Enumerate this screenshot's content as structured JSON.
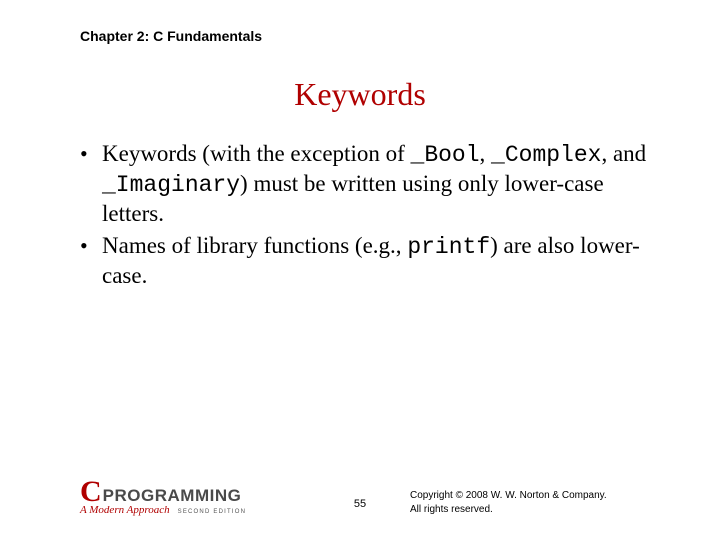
{
  "chapter": "Chapter 2: C Fundamentals",
  "title": "Keywords",
  "bullets": [
    {
      "pre": "Keywords (with the exception of ",
      "c1": "_Bool",
      "mid1": ", ",
      "c2": "_Complex",
      "mid2": ", and ",
      "c3": "_Imaginary",
      "post": ") must be written using only lower-case letters."
    },
    {
      "pre": "Names of library functions (e.g., ",
      "c1": "printf",
      "post": ") are also lower-case."
    }
  ],
  "logo": {
    "c": "C",
    "prog": "PROGRAMMING",
    "sub": "A Modern Approach",
    "ed": "SECOND EDITION"
  },
  "page": "55",
  "copyright_l1": "Copyright © 2008 W. W. Norton & Company.",
  "copyright_l2": "All rights reserved."
}
